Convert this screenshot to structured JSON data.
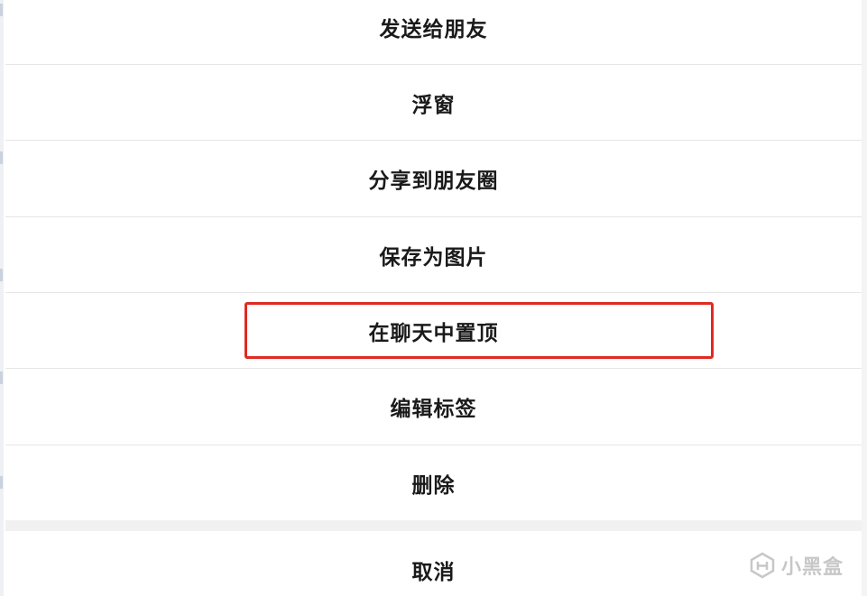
{
  "action_sheet": {
    "items": [
      {
        "label": "发送给朋友"
      },
      {
        "label": "浮窗"
      },
      {
        "label": "分享到朋友圈"
      },
      {
        "label": "保存为图片"
      },
      {
        "label": "在聊天中置顶"
      },
      {
        "label": "编辑标签"
      },
      {
        "label": "删除"
      }
    ],
    "cancel_label": "取消",
    "highlighted_item": "在聊天中置顶",
    "highlight_color": "#e02a22"
  },
  "watermark": {
    "text": "小黑盒",
    "icon": "heybox-logo-icon"
  }
}
